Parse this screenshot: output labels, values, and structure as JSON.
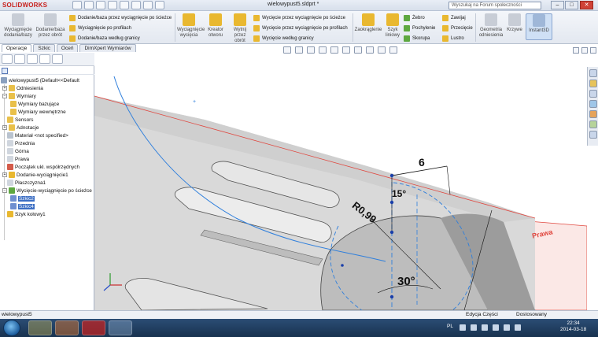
{
  "titlebar": {
    "app_name": "SOLIDWORKS",
    "document_title": "wielowypust5.sldprt *",
    "search_placeholder": "Wyszukaj na Forum społeczności",
    "minimize": "–",
    "restore": "□",
    "close": "✕"
  },
  "ribbon": {
    "extrude_boss": "Wyciągnięcie dodania/bazy",
    "revolve_boss": "Dodanie/baza przez obrót",
    "sweep_boss": "Dodanie/baza przez wyciągnięcie po ścieżce",
    "loft_boss": "Wyciągnięcie po profilach",
    "boundary_boss": "Dodanie/baza według granicy",
    "extruded_cut": "Wyciągnięcie wycięcia",
    "hole_wizard": "Kreator otworu",
    "revolved_cut": "Wytnij przez obrót",
    "swept_cut": "Wycięcie przez wyciągnięcie po ścieżce",
    "lofted_cut": "Wycięcie przez wyciągnięcie po profilach",
    "boundary_cut": "Wycięcie według granicy",
    "fillet": "Zaokrąglenie",
    "linear_pattern": "Szyk liniowy",
    "rib": "Żebro",
    "draft": "Pochylenie",
    "shell": "Skorupa",
    "wrap": "Zawijaj",
    "intersect": "Przecięcie",
    "mirror": "Lustro",
    "reference_geometry": "Geometria odniesienia",
    "curves": "Krzywe",
    "instant3d": "Instant3D"
  },
  "tabs": [
    "Operacje",
    "Szkic",
    "Oceń",
    "DimXpert Wymiarów"
  ],
  "tree": {
    "root": "wielowypust5  (Default<<Default",
    "items": [
      "Odniesienia",
      "Wymiary",
      "Wymiary bazujące",
      "Wymiary wewnętrzne",
      "Sensors",
      "Adnotacje",
      "Materiał <not specified>",
      "Przednia",
      "Górna",
      "Prawa",
      "Początek ukł. współrzędnych",
      "Dodanie-wyciągnięcie1",
      "Płaszczyzna1",
      "Wycięcie-wyciągnięcie po ścieżce",
      "Szkic2",
      "Szkic4",
      "Szyk kołowy1"
    ]
  },
  "viewport": {
    "dim_6": "6",
    "dim_radius": "R0,99",
    "dim_15": "15°",
    "dim_30": "30°",
    "plane_label": "Prawa"
  },
  "statusbar": {
    "left": "wielowypust5",
    "edit": "Edycja Części",
    "units": "Dostosowany"
  },
  "taskbar": {
    "lang": "PL",
    "time": "22:34",
    "date": "2014-03-18"
  },
  "colors": {
    "sw_red": "#c8201c",
    "selection_blue": "#3d6fc4",
    "sketch_blue": "#2f7fdc",
    "plane_red": "#e0473f"
  }
}
